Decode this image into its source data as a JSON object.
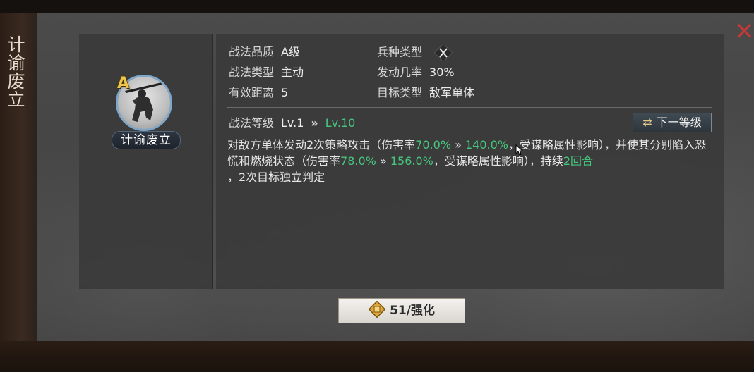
{
  "window": {
    "title": "计谕废立",
    "close_label": "✕"
  },
  "skill": {
    "grade": "A",
    "name": "计谕废立"
  },
  "attributes": {
    "quality_label": "战法品质",
    "quality_value": "A级",
    "troop_label": "兵种类型",
    "troop_icon": "crossed-troops-icon",
    "type_label": "战法类型",
    "type_value": "主动",
    "rate_label": "发动几率",
    "rate_value": "30%",
    "range_label": "有效距离",
    "range_value": "5",
    "target_label": "目标类型",
    "target_value": "敌军单体"
  },
  "level": {
    "label": "战法等级",
    "current": "Lv.1",
    "arrow": "»",
    "max": "Lv.10",
    "next_button_icon": "⇄",
    "next_button_label": "下一等级"
  },
  "description": {
    "p1": "对敌方单体发动2次策略攻击（伤害率",
    "v1a": "70.0%",
    "arrow": "»",
    "v1b": "140.0%",
    "p2": "，受谋略属性影响），并使其分别陷入恐慌和燃烧状态（伤害率",
    "v2a": "78.0%",
    "v2b": "156.0%",
    "p3": "，受谋略属性影响），持续",
    "v3": "2回合",
    "p4": "，2次目标独立判定"
  },
  "enhance_button": {
    "label": "51/强化",
    "icon": "fist-coin-icon"
  },
  "colors": {
    "highlight_green": "#46c77e",
    "grade_gold": "#f0c64a",
    "close_red": "#c03a3a"
  }
}
